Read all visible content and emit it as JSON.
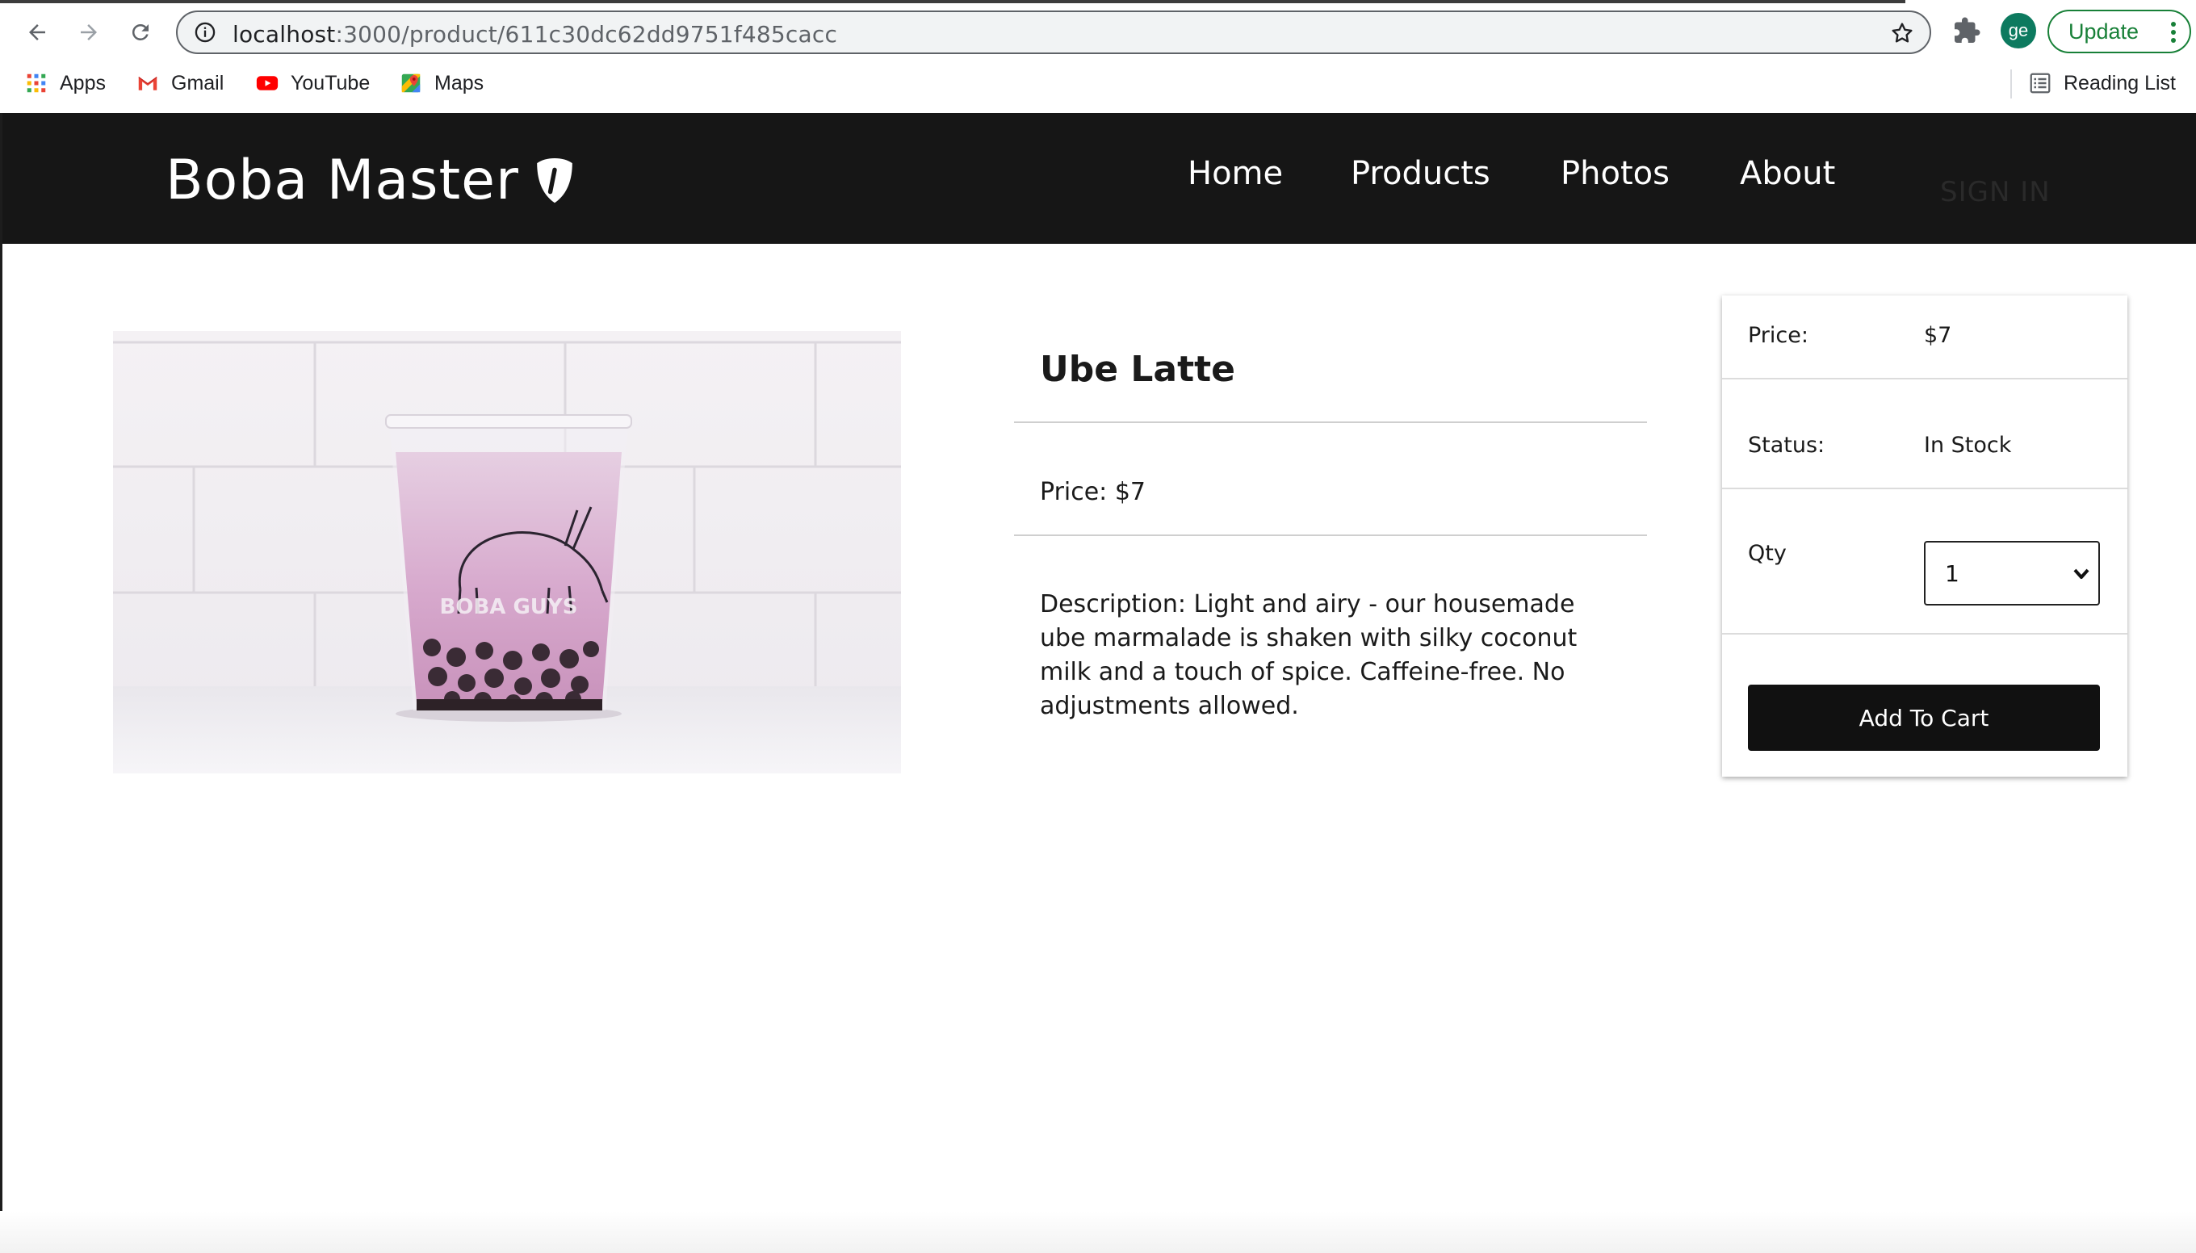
{
  "browser": {
    "url_host": "localhost",
    "url_path": ":3000/product/611c30dc62dd9751f485cacc",
    "avatar_initials": "ge",
    "update_label": "Update",
    "bookmarks": [
      {
        "label": "Apps",
        "icon": "apps-grid-icon"
      },
      {
        "label": "Gmail",
        "icon": "gmail-icon"
      },
      {
        "label": "YouTube",
        "icon": "youtube-icon"
      },
      {
        "label": "Maps",
        "icon": "maps-icon"
      }
    ],
    "reading_list_label": "Reading List"
  },
  "header": {
    "brand": "Boba Master",
    "nav": [
      "Home",
      "Products",
      "Photos",
      "About"
    ],
    "signin": "SIGN IN"
  },
  "product": {
    "name": "Ube Latte",
    "price_line": "Price: $7",
    "description": "Description: Light and airy - our housemade ube marmalade is shaken with silky coconut milk and a touch of spice. Caffeine-free. No adjustments allowed.",
    "image_cup_text": "BOBA GUYS"
  },
  "card": {
    "price_label": "Price:",
    "price_value": "$7",
    "status_label": "Status:",
    "status_value": "In Stock",
    "qty_label": "Qty",
    "qty_value": "1",
    "add_to_cart": "Add To Cart"
  },
  "colors": {
    "header_bg": "#161616",
    "accent_green": "#188038",
    "button_bg": "#111111"
  }
}
